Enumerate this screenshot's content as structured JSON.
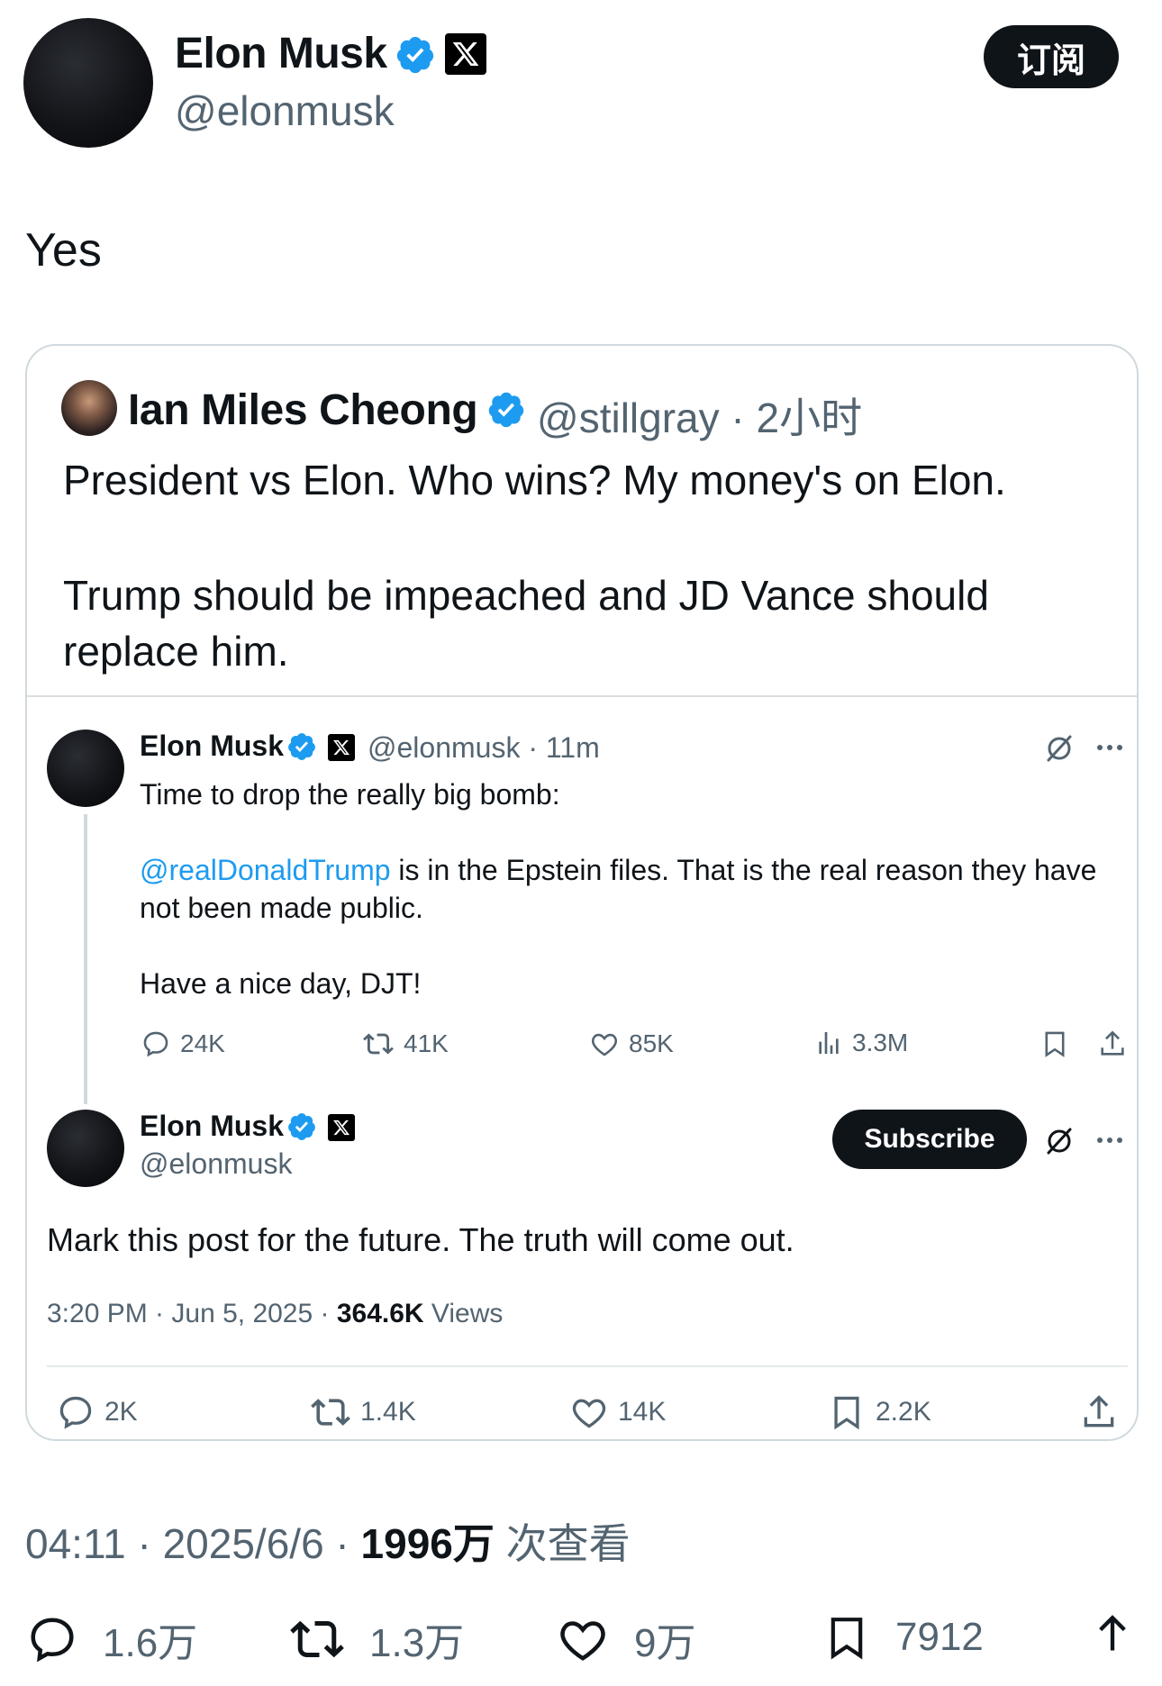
{
  "author": {
    "name": "Elon Musk",
    "handle": "@elonmusk",
    "subscribe_label": "订阅"
  },
  "post": {
    "text": "Yes",
    "time": "04:11",
    "date": "2025/6/6",
    "views_count": "1996万",
    "views_label": "次查看",
    "stats": {
      "replies": "1.6万",
      "reposts": "1.3万",
      "likes": "9万",
      "bookmarks": "7912"
    }
  },
  "quote": {
    "name": "Ian Miles Cheong",
    "handle_time": "@stillgray · 2小时",
    "text_line1": "President vs Elon. Who wins? My money's on Elon.",
    "text_line2": "Trump should be impeached and JD Vance should replace him."
  },
  "embedded": {
    "tweet1": {
      "name": "Elon Musk",
      "handle_time": "@elonmusk · 11m",
      "line1": "Time to drop the really big bomb:",
      "mention": "@realDonaldTrump",
      "line2_rest": " is in the Epstein files. That is the real reason they have",
      "line3": "not been made public.",
      "line4": "Have a nice day, DJT!",
      "stats": {
        "replies": "24K",
        "reposts": "41K",
        "likes": "85K",
        "views": "3.3M"
      }
    },
    "tweet2": {
      "name": "Elon Musk",
      "handle": "@elonmusk",
      "subscribe_label": "Subscribe",
      "text": "Mark this post for the future. The truth will come out.",
      "time_date": "3:20 PM · Jun 5, 2025 · ",
      "views_count": "364.6K",
      "views_label": " Views",
      "stats": {
        "replies": "2K",
        "reposts": "1.4K",
        "likes": "14K",
        "bookmarks": "2.2K"
      }
    }
  },
  "colors": {
    "accent": "#1d9bf0",
    "text": "#0f1419",
    "secondary": "#536471",
    "border": "#cfd9de"
  },
  "icons": [
    "verified-badge-icon",
    "x-logo-icon",
    "reply-icon",
    "repost-icon",
    "like-icon",
    "views-icon",
    "bookmark-icon",
    "share-icon",
    "grok-icon",
    "more-icon"
  ]
}
